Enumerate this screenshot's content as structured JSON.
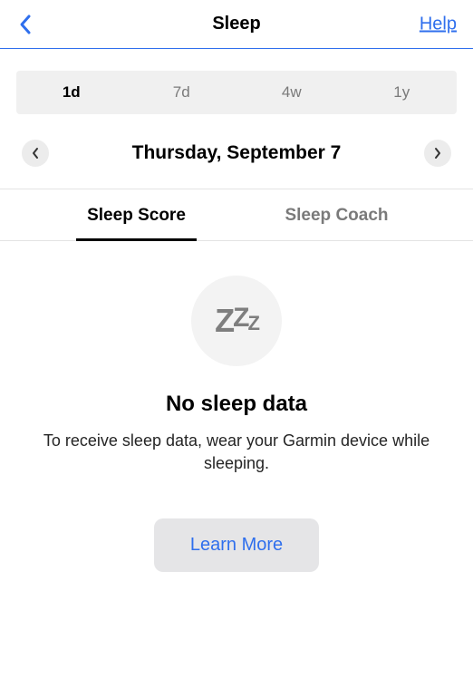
{
  "header": {
    "title": "Sleep",
    "help_label": "Help"
  },
  "range": {
    "items": [
      {
        "label": "1d",
        "active": true
      },
      {
        "label": "7d",
        "active": false
      },
      {
        "label": "4w",
        "active": false
      },
      {
        "label": "1y",
        "active": false
      }
    ]
  },
  "date": {
    "label": "Thursday, September 7"
  },
  "tabs": {
    "items": [
      {
        "label": "Sleep Score",
        "active": true
      },
      {
        "label": "Sleep Coach",
        "active": false
      }
    ]
  },
  "empty": {
    "icon": "sleep-zzz",
    "title": "No sleep data",
    "body": "To receive sleep data, wear your Garmin device while sleeping.",
    "cta": "Learn More"
  }
}
